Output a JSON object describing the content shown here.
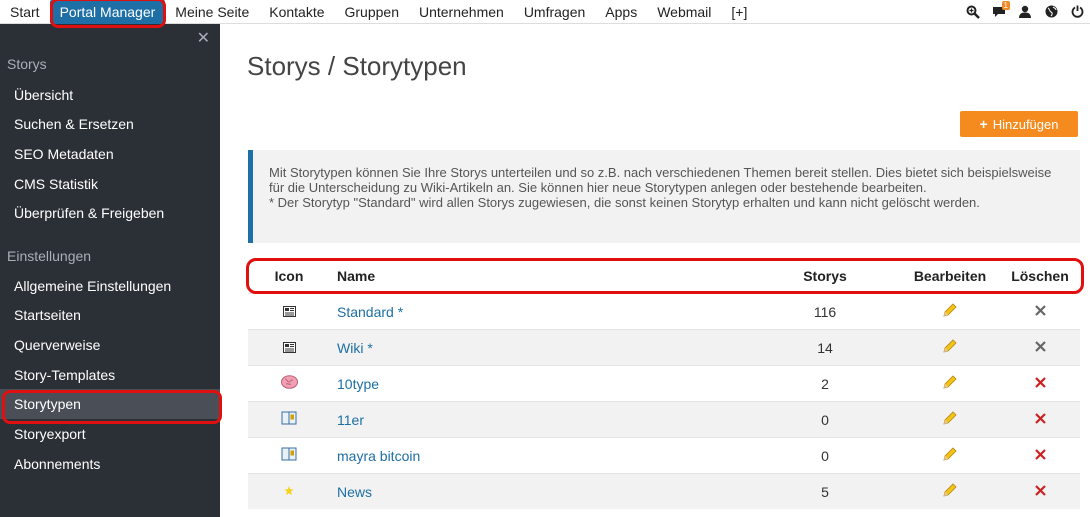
{
  "topnav": {
    "items": [
      "Start",
      "Portal Manager",
      "Meine Seite",
      "Kontakte",
      "Gruppen",
      "Unternehmen",
      "Umfragen",
      "Apps",
      "Webmail",
      "[+]"
    ],
    "active_index": 1,
    "notification_count": "1"
  },
  "sidebar": {
    "sections": [
      {
        "title": "Storys",
        "items": [
          "Übersicht",
          "Suchen & Ersetzen",
          "SEO Metadaten",
          "CMS Statistik",
          "Überprüfen & Freigeben"
        ]
      },
      {
        "title": "Einstellungen",
        "items": [
          "Allgemeine Einstellungen",
          "Startseiten",
          "Querverweise",
          "Story-Templates",
          "Storytypen",
          "Storyexport",
          "Abonnements"
        ]
      }
    ],
    "active_item": "Storytypen"
  },
  "page": {
    "title": "Storys / Storytypen",
    "add_button": "Hinzufügen"
  },
  "info": {
    "text1": "Mit Storytypen können Sie Ihre Storys unterteilen und so z.B. nach verschiedenen Themen bereit stellen. Dies bietet sich beispielsweise für die Unterscheidung zu Wiki-Artikeln an. Sie können hier neue Storytypen anlegen oder bestehende bearbeiten.",
    "text2": "* Der Storytyp \"Standard\" wird allen Storys zugewiesen, die sonst keinen Storytyp erhalten und kann nicht gelöscht werden."
  },
  "table": {
    "headers": {
      "icon": "Icon",
      "name": "Name",
      "count": "Storys",
      "edit": "Bearbeiten",
      "delete": "Löschen"
    },
    "rows": [
      {
        "icon": "newspaper-icon",
        "name": "Standard *",
        "count": "116",
        "deletable": false
      },
      {
        "icon": "newspaper-icon",
        "name": "Wiki *",
        "count": "14",
        "deletable": false
      },
      {
        "icon": "brain-icon",
        "name": "10type",
        "count": "2",
        "deletable": true
      },
      {
        "icon": "book-icon",
        "name": "11er",
        "count": "0",
        "deletable": true
      },
      {
        "icon": "book-icon",
        "name": "mayra bitcoin",
        "count": "0",
        "deletable": true
      },
      {
        "icon": "star-icon",
        "name": "News",
        "count": "5",
        "deletable": true
      }
    ]
  },
  "colors": {
    "accent": "#1d6fa5",
    "button": "#f58a1e",
    "highlight": "#e01010",
    "sidebar": "#2b2f36",
    "delete_active": "#cc2222",
    "delete_disabled": "#666666"
  }
}
